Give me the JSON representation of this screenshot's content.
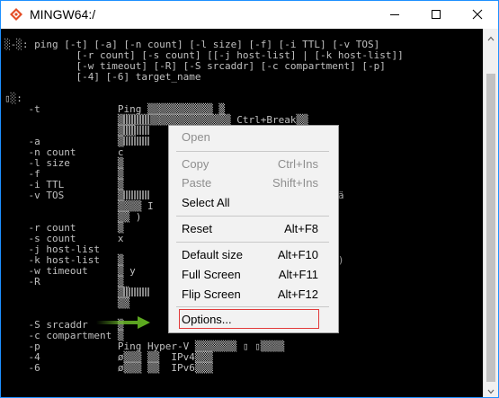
{
  "window": {
    "title": "MINGW64:/",
    "border_color": "#1e90ff",
    "icons": {
      "app": "mingw-icon",
      "minimize": "minimize-icon",
      "maximize": "maximize-icon",
      "close": "close-icon"
    }
  },
  "terminal": {
    "lines": [
      "░-░: ping [-t] [-a] [-n count] [-l size] [-f] [-i TTL] [-v TOS]",
      "            [-r count] [-s count] [[-j host-list] | [-k host-list]]",
      "            [-w timeout] [-R] [-S srcaddr] [-c compartment] [-p]",
      "            [-4] [-6] target_name",
      "",
      "▯░:",
      "    -t             Ping ▒▒▒▒▒▒▒▒▒▒▒ ▒",
      "                   ▒▒▒▒▒▒▒▒▒▒▒▒▒▒▒▒▒▒▒ Ctrl+Break▒▒",
      "                   ▒▒▒",
      "    -a             ▒",
      "    -n count       c",
      "    -l size        ▒",
      "    -f             ▒                                v4)",
      "    -i TTL         ▒",
      "    -v TOS         ▒                                ▒▒▒ ä",
      "                   ▒▒▒▒ I",
      "                   ▒▒ )",
      "    -r count       ▒",
      "    -s count       x",
      "    -j host-list                                    Pv4)",
      "    -k host-list   ▒                                IPv4)",
      "    -w timeout     ▒ y",
      "    -R             ▒                                )",
      "                   ▒▒",
      "                   ▒▒",
      "    -S srcaddr     ▒",
      "    -c compartment ▒",
      "    -p             Ping Hyper-V ▒▒▒▒▒▒▒ ▯ ▯▒▒▒▒",
      "    -4             ø▒▒▒ ▒▒  IPv4▒▒▒",
      "    -6             ø▒▒▒ ▒▒  IPv6▒▒▒"
    ]
  },
  "context_menu": {
    "items": [
      {
        "label": "Open",
        "shortcut": "",
        "enabled": false
      },
      {
        "label": "Copy",
        "shortcut": "Ctrl+Ins",
        "enabled": false
      },
      {
        "label": "Paste",
        "shortcut": "Shift+Ins",
        "enabled": false
      },
      {
        "label": "Select All",
        "shortcut": "",
        "enabled": true
      },
      {
        "label": "Reset",
        "shortcut": "Alt+F8",
        "enabled": true
      },
      {
        "label": "Default size",
        "shortcut": "Alt+F10",
        "enabled": true
      },
      {
        "label": "Full Screen",
        "shortcut": "Alt+F11",
        "enabled": true
      },
      {
        "label": "Flip Screen",
        "shortcut": "Alt+F12",
        "enabled": true
      },
      {
        "label": "Options...",
        "shortcut": "",
        "enabled": true
      }
    ],
    "highlight_color": "#e23b3b",
    "arrow_color": "#6fbf2a"
  }
}
